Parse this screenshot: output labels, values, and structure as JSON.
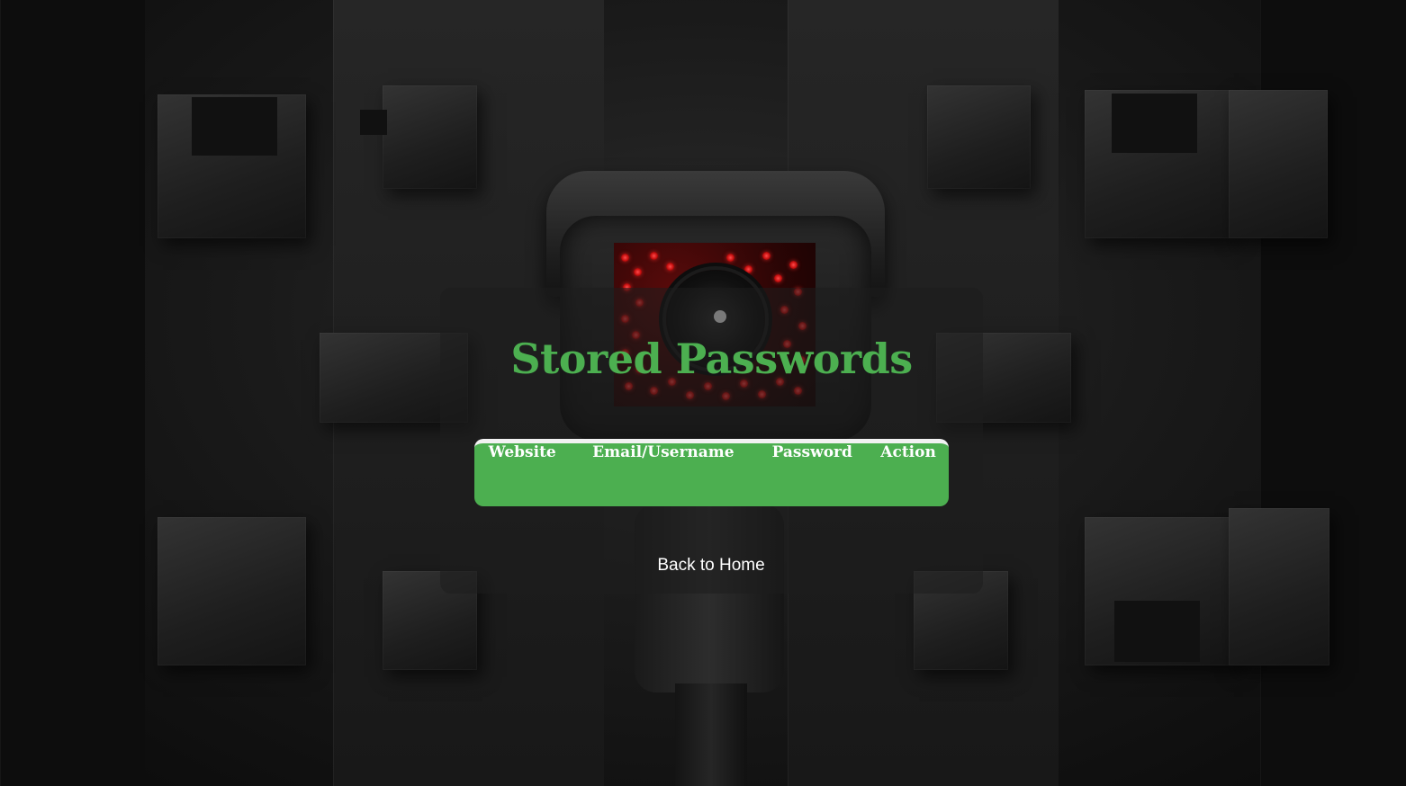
{
  "page": {
    "title": "Stored Passwords",
    "accent_color": "#4caf50",
    "background_image": "security-camera-dark-wall"
  },
  "table": {
    "headers": [
      "Website",
      "Email/Username",
      "Password",
      "Action"
    ],
    "rows": []
  },
  "links": {
    "back_home": "Back to Home"
  }
}
